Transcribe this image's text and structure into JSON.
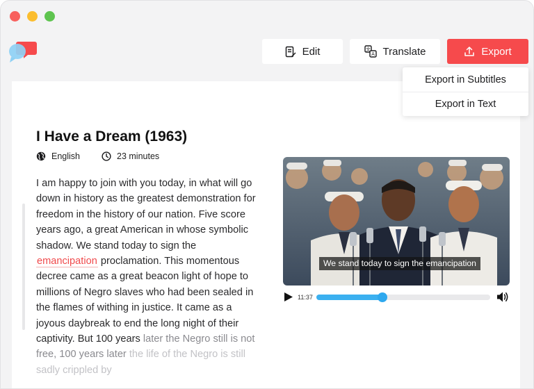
{
  "toolbar": {
    "edit_label": "Edit",
    "translate_label": "Translate",
    "export_label": "Export"
  },
  "export_menu": {
    "items": [
      "Export in Subtitles",
      "Export in Text"
    ]
  },
  "document": {
    "title": "I Have a Dream (1963)",
    "language": "English",
    "duration": "23 minutes"
  },
  "transcript": {
    "part1": "I am happy to join with you today, in what will go down in history as the greatest demonstration for freedom in the history of our nation. Five score years ago, a great American in whose symbolic shadow. We stand today to sign the ",
    "highlight": "emancipation",
    "part2": " proclamation. This momentous decree came as a great beacon light of hope to millions of Negro slaves who had been sealed in the flames of withing in justice. It came as a joyous daybreak to end the long night of their captivity. But 100 years ",
    "faded1": "later the Negro still is not free, 100 years later ",
    "faded2": "the life of the Negro is still sadly crippled by"
  },
  "video": {
    "caption": "We stand today to sign the emancipation",
    "current_time": "11:37",
    "progress_fraction": 0.38
  },
  "colors": {
    "accent_red": "#f64a4c",
    "progress_blue": "#3bb0f0"
  }
}
